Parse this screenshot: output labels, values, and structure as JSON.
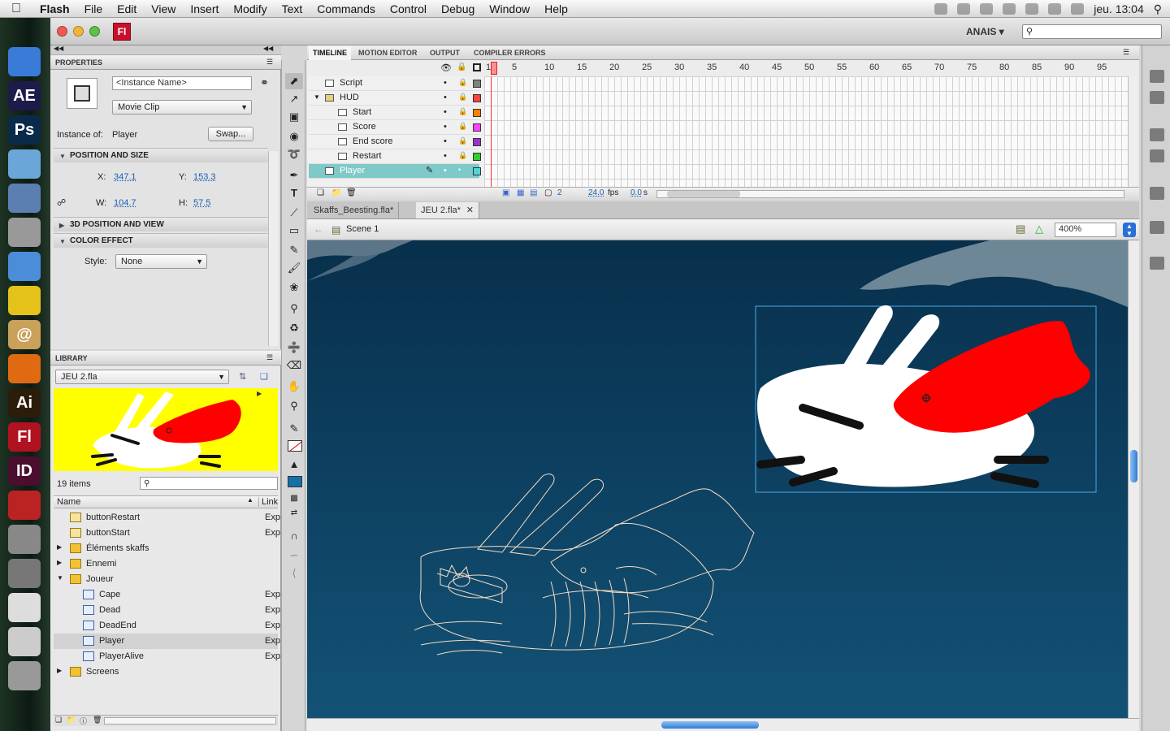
{
  "menubar": {
    "app": "Flash",
    "items": [
      "File",
      "Edit",
      "View",
      "Insert",
      "Modify",
      "Text",
      "Commands",
      "Control",
      "Debug",
      "Window",
      "Help"
    ],
    "clock": "jeu. 13:04"
  },
  "dock": {
    "apps": [
      {
        "label": "",
        "name": "finder-icon",
        "color": "#3b7bd8"
      },
      {
        "label": "AE",
        "name": "after-effects-icon",
        "color": "#1d1b4b"
      },
      {
        "label": "Ps",
        "name": "photoshop-icon",
        "color": "#0b2a4a"
      },
      {
        "label": "",
        "name": "box-app-icon",
        "color": "#6aa6d8"
      },
      {
        "label": "",
        "name": "preview-icon",
        "color": "#5a7fb0"
      },
      {
        "label": "",
        "name": "iphoto-icon",
        "color": "#999"
      },
      {
        "label": "",
        "name": "itunes-icon",
        "color": "#4b8dd8"
      },
      {
        "label": "",
        "name": "adium-icon",
        "color": "#e4c21a"
      },
      {
        "label": "@",
        "name": "mail-icon",
        "color": "#c9a15a"
      },
      {
        "label": "",
        "name": "firefox-icon",
        "color": "#e06a12"
      },
      {
        "label": "Ai",
        "name": "illustrator-icon",
        "color": "#2c1d0a"
      },
      {
        "label": "Fl",
        "name": "flash-icon",
        "color": "#b0121f"
      },
      {
        "label": "ID",
        "name": "indesign-icon",
        "color": "#4a0e2e"
      },
      {
        "label": "",
        "name": "pdf-icon",
        "color": "#b22"
      },
      {
        "label": "",
        "name": "script-icon",
        "color": "#888"
      },
      {
        "label": "",
        "name": "utility-icon",
        "color": "#777"
      },
      {
        "label": "",
        "name": "textedit-icon",
        "color": "#ddd"
      },
      {
        "label": "",
        "name": "document-icon",
        "color": "#ccc"
      },
      {
        "label": "",
        "name": "trash-icon",
        "color": "#999"
      }
    ]
  },
  "window": {
    "app_badge": "Fl",
    "workspace": "ANAIS ▾"
  },
  "properties": {
    "title": "PROPERTIES",
    "instance_placeholder": "<Instance Name>",
    "symbol_type": "Movie Clip",
    "instance_of_label": "Instance of:",
    "instance_of": "Player",
    "swap": "Swap...",
    "pos_size": "POSITION AND SIZE",
    "x_label": "X:",
    "x": "347.1",
    "y_label": "Y:",
    "y": "153.3",
    "w_label": "W:",
    "w": "104.7",
    "h_label": "H:",
    "h": "57.5",
    "pos3d": "3D POSITION AND VIEW",
    "color_effect": "COLOR EFFECT",
    "style_label": "Style:",
    "style": "None"
  },
  "library": {
    "title": "LIBRARY",
    "file": "JEU 2.fla",
    "count": "19 items",
    "col_name": "Name",
    "col_link": "Link",
    "items": [
      {
        "name": "buttonRestart",
        "link": "Exp",
        "indent": 0,
        "type": "button",
        "expand": ""
      },
      {
        "name": "buttonStart",
        "link": "Exp",
        "indent": 0,
        "type": "button",
        "expand": ""
      },
      {
        "name": "Éléments skaffs",
        "link": "",
        "indent": 0,
        "type": "folder",
        "expand": "▶"
      },
      {
        "name": "Ennemi",
        "link": "",
        "indent": 0,
        "type": "folder",
        "expand": "▶"
      },
      {
        "name": "Joueur",
        "link": "",
        "indent": 0,
        "type": "folder-open",
        "expand": "▼"
      },
      {
        "name": "Cape",
        "link": "Exp",
        "indent": 1,
        "type": "clip",
        "expand": ""
      },
      {
        "name": "Dead",
        "link": "Exp",
        "indent": 1,
        "type": "clip",
        "expand": ""
      },
      {
        "name": "DeadEnd",
        "link": "Exp",
        "indent": 1,
        "type": "clip",
        "expand": ""
      },
      {
        "name": "Player",
        "link": "Exp",
        "indent": 1,
        "type": "clip",
        "expand": "",
        "selected": true
      },
      {
        "name": "PlayerAlive",
        "link": "Exp",
        "indent": 1,
        "type": "clip",
        "expand": ""
      },
      {
        "name": "Screens",
        "link": "",
        "indent": 0,
        "type": "folder",
        "expand": "▶"
      }
    ]
  },
  "timeline": {
    "tabs": [
      "TIMELINE",
      "MOTION EDITOR",
      "OUTPUT",
      "COMPILER ERRORS"
    ],
    "frame_numbers": [
      "1",
      "5",
      "10",
      "15",
      "20",
      "25",
      "30",
      "35",
      "40",
      "45",
      "50",
      "55",
      "60",
      "65",
      "70",
      "75",
      "80",
      "85",
      "90",
      "95"
    ],
    "layers": [
      {
        "name": "Script",
        "indent": 0,
        "color": "#808080",
        "folder": false
      },
      {
        "name": "HUD",
        "indent": 0,
        "color": "#ff4040",
        "folder": true
      },
      {
        "name": "Start",
        "indent": 1,
        "color": "#ff8000",
        "folder": false
      },
      {
        "name": "Score",
        "indent": 1,
        "color": "#ff40ff",
        "folder": false
      },
      {
        "name": "End score",
        "indent": 1,
        "color": "#9933cc",
        "folder": false
      },
      {
        "name": "Restart",
        "indent": 1,
        "color": "#33cc33",
        "folder": false
      },
      {
        "name": "Player",
        "indent": 0,
        "color": "#4fd6d6",
        "folder": false,
        "selected": true
      }
    ],
    "current_frame": "2",
    "fps": "24.0",
    "fps_unit": "fps",
    "time": "0.0",
    "time_unit": "s"
  },
  "documents": {
    "tabs": [
      "Skaffs_Beesting.fla*",
      "JEU 2.fla*"
    ],
    "active": 1,
    "scene": "Scene 1",
    "zoom": "400%"
  }
}
